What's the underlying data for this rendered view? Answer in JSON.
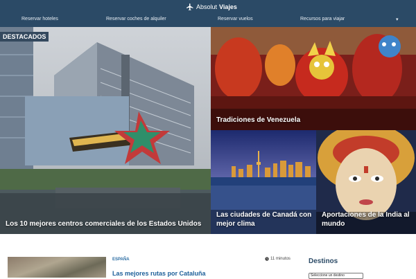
{
  "header": {
    "logo_light": "Absolut",
    "logo_bold": "Viajes",
    "nav": [
      "Reservar hoteles",
      "Reservar coches de alquiler",
      "Reservar vuelos",
      "Recursos para viajar"
    ],
    "more_arrow": "▾"
  },
  "featured": {
    "badge": "DESTACADOS",
    "tiles": [
      "Los 10 mejores centros comerciales de los Estados Unidos",
      "Tradiciones de Venezuela",
      "Las ciudades de Canadá con mejor clima",
      "Aportaciones de la India al mundo"
    ]
  },
  "post": {
    "category": "ESPAÑA",
    "read_time": "11 minutos",
    "title": "Las mejores rutas por Cataluña"
  },
  "sidebar": {
    "title": "Destinos",
    "select_value": "Seleccione un destino"
  }
}
